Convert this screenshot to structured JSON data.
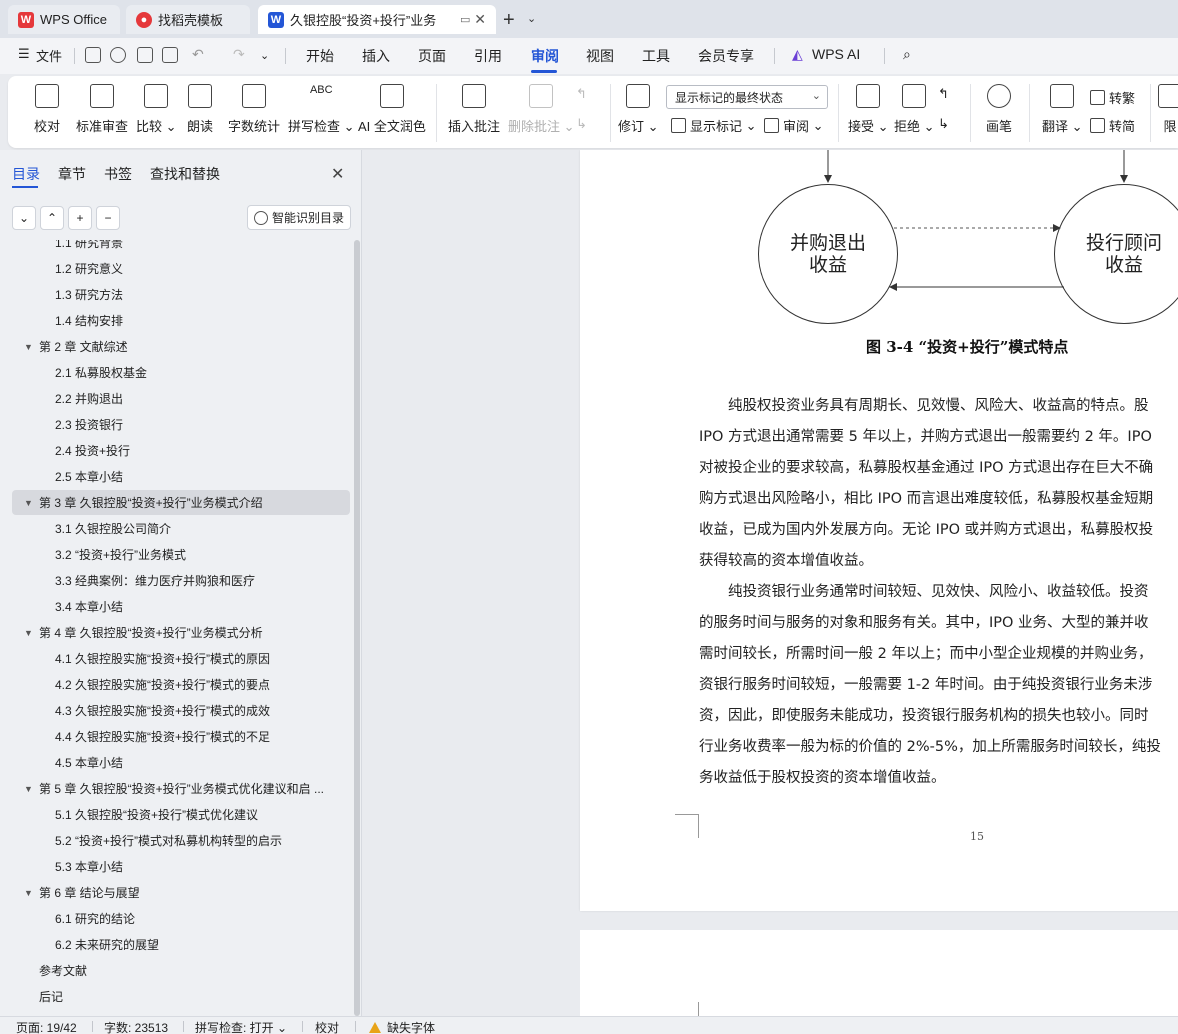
{
  "tabs": [
    {
      "label": "WPS Office",
      "icon": "wps-logo-icon",
      "color": "#e5383b"
    },
    {
      "label": "找稻壳模板",
      "icon": "docer-icon",
      "color": "#e5383b"
    },
    {
      "label": "久银控股“投资+投行”业务",
      "icon": "word-doc-icon",
      "color": "#2456d6"
    }
  ],
  "menu": {
    "file": "文件",
    "items": [
      "开始",
      "插入",
      "页面",
      "引用",
      "审阅",
      "视图",
      "工具",
      "会员专享"
    ],
    "active": "审阅",
    "ai": "WPS AI"
  },
  "ribbon": {
    "proofread": "校对",
    "standard_review": "标准审查",
    "compare": "比较",
    "read_aloud": "朗读",
    "word_count": "字数统计",
    "spell_check": "拼写检查",
    "ai_polish": "AI 全文润色",
    "insert_comment": "插入批注",
    "delete_comment": "删除批注",
    "track_changes": "修订",
    "markup_select": "显示标记的最终状态",
    "show_markup": "显示标记",
    "review_pane": "审阅",
    "accept": "接受",
    "reject": "拒绝",
    "pen": "画笔",
    "translate": "翻译",
    "to_traditional": "转繁",
    "to_simplified": "转简",
    "restrict": "限"
  },
  "nav": {
    "tabs": [
      "目录",
      "章节",
      "书签",
      "查找和替换"
    ],
    "smart_toc": "智能识别目录",
    "toc": [
      {
        "label": "1.1  研究背景",
        "level": 2
      },
      {
        "label": "1.2  研究意义",
        "level": 2
      },
      {
        "label": "1.3  研究方法",
        "level": 2
      },
      {
        "label": "1.4  结构安排",
        "level": 2
      },
      {
        "label": "第 2 章  文献综述",
        "level": 1
      },
      {
        "label": "2.1  私募股权基金",
        "level": 2
      },
      {
        "label": "2.2  并购退出",
        "level": 2
      },
      {
        "label": "2.3  投资银行",
        "level": 2
      },
      {
        "label": "2.4  投资+投行",
        "level": 2
      },
      {
        "label": "2.5  本章小结",
        "level": 2
      },
      {
        "label": "第 3 章  久银控股“投资+投行”业务模式介绍",
        "level": 1,
        "selected": true
      },
      {
        "label": "3.1  久银控股公司简介",
        "level": 2
      },
      {
        "label": "3.2  “投资+投行”业务模式",
        "level": 2
      },
      {
        "label": "3.3  经典案例：维力医疗并购狼和医疗",
        "level": 2
      },
      {
        "label": "3.4  本章小结",
        "level": 2
      },
      {
        "label": "第 4 章  久银控股“投资+投行”业务模式分析",
        "level": 1
      },
      {
        "label": "4.1  久银控股实施“投资+投行”模式的原因",
        "level": 2
      },
      {
        "label": "4.2  久银控股实施“投资+投行”模式的要点",
        "level": 2
      },
      {
        "label": "4.3  久银控股实施“投资+投行”模式的成效",
        "level": 2
      },
      {
        "label": "4.4  久银控股实施“投资+投行”模式的不足",
        "level": 2
      },
      {
        "label": "4.5  本章小结",
        "level": 2
      },
      {
        "label": "第 5 章  久银控股“投资+投行”业务模式优化建议和启 ...",
        "level": 1
      },
      {
        "label": "5.1  久银控股“投资+投行”模式优化建议",
        "level": 2
      },
      {
        "label": "5.2  “投资+投行”模式对私募机构转型的启示",
        "level": 2
      },
      {
        "label": "5.3  本章小结",
        "level": 2
      },
      {
        "label": "第 6 章  结论与展望",
        "level": 1
      },
      {
        "label": "6.1  研究的结论",
        "level": 2
      },
      {
        "label": "6.2  未来研究的展望",
        "level": 2
      },
      {
        "label": "参考文献",
        "level": 0
      },
      {
        "label": "后记",
        "level": 0
      }
    ]
  },
  "document": {
    "node_left": "并购退出\n收益",
    "node_right": "投行顾问\n收益",
    "figure_caption": "图 3-4  “投资+投行”模式特点",
    "lines": [
      "　　纯股权投资业务具有周期长、见效慢、风险大、收益高的特点。股",
      "IPO 方式退出通常需要 5 年以上，并购方式退出一般需要约 2 年。IPO",
      "对被投企业的要求较高，私募股权基金通过 IPO 方式退出存在巨大不确",
      "购方式退出风险略小，相比 IPO 而言退出难度较低，私募股权基金短期",
      "收益，已成为国内外发展方向。无论 IPO 或并购方式退出，私募股权投",
      "获得较高的资本增值收益。",
      "　　纯投资银行业务通常时间较短、见效快、风险小、收益较低。投资",
      "的服务时间与服务的对象和服务有关。其中，IPO 业务、大型的兼并收",
      "需时间较长，所需时间一般 2 年以上；而中小型企业规模的并购业务，",
      "资银行服务时间较短，一般需要 1-2 年时间。由于纯投资银行业务未涉",
      "资，因此，即使服务未能成功，投资银行服务机构的损失也较小。同时",
      "行业务收费率一般为标的价值的 2%-5%，加上所需服务时间较长，纯投",
      "务收益低于股权投资的资本增值收益。"
    ],
    "page_number": "15"
  },
  "status": {
    "page": "页面: 19/42",
    "words": "字数: 23513",
    "spell": "拼写检查: 打开",
    "proof": "校对",
    "missing_font": "缺失字体"
  }
}
